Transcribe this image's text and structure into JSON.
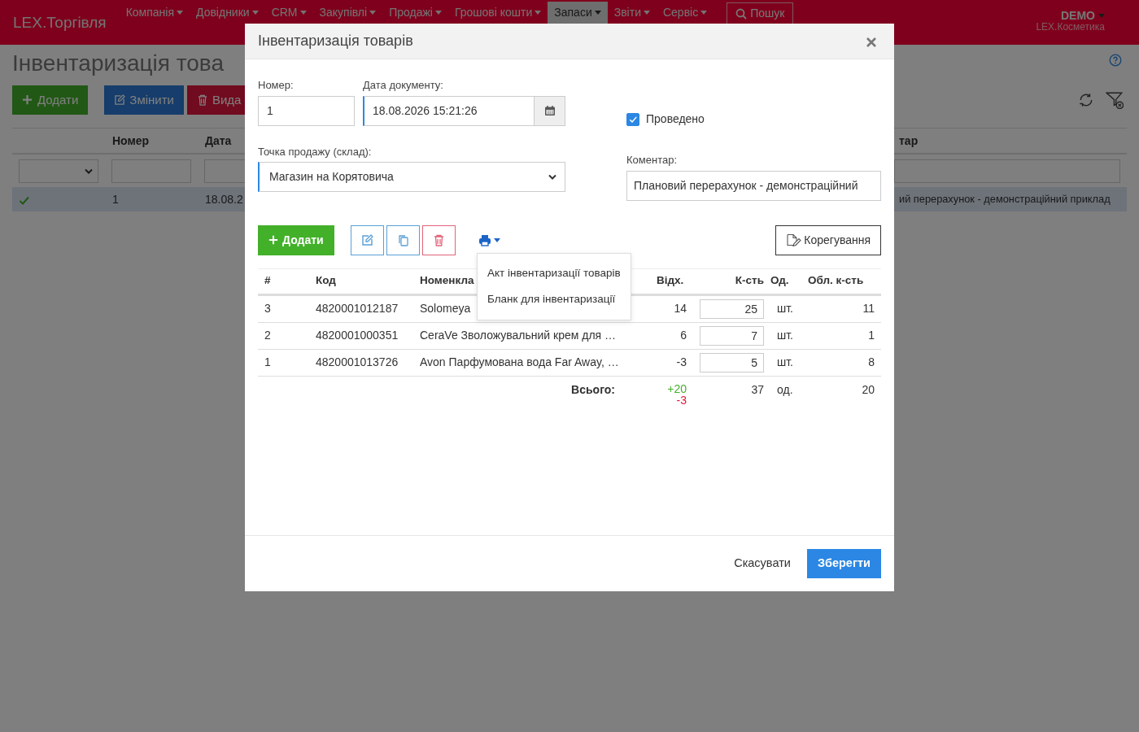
{
  "navbar": {
    "brand": "LEX.Торгівля",
    "menus": [
      {
        "label": "Компанія",
        "selected": false
      },
      {
        "label": "Довідники",
        "selected": false
      },
      {
        "label": "CRM",
        "selected": false
      },
      {
        "label": "Закупівлі",
        "selected": false
      },
      {
        "label": "Продажі",
        "selected": false
      },
      {
        "label": "Грошові кошти",
        "selected": false
      },
      {
        "label": "Запаси",
        "selected": true
      },
      {
        "label": "Звіти",
        "selected": false
      },
      {
        "label": "Сервіс",
        "selected": false
      }
    ],
    "search_button": "Пошук",
    "user": {
      "name": "DEMO",
      "company": "LEX.Косметика"
    }
  },
  "page": {
    "title": "Інвентаризація това",
    "buttons": [
      {
        "label": "Додати",
        "kind": "add"
      },
      {
        "label": "Змінити",
        "kind": "edit"
      },
      {
        "label": "Вида",
        "kind": "delete"
      }
    ],
    "table": {
      "columns": [
        "Номер",
        "Дата"
      ],
      "last_column": "тар",
      "rows": [
        {
          "posted": true,
          "number": "1",
          "date": "18.08.2",
          "comment": "ий перерахунок - демонстраційний приклад",
          "selected": true
        }
      ]
    }
  },
  "dialog": {
    "title": "Інвентаризація товарів",
    "number": {
      "label": "Номер:",
      "value": "1"
    },
    "date": {
      "label": "Дата документу:",
      "value": "18.08.2026 15:21:26"
    },
    "posted": {
      "label": "Проведено",
      "checked": true
    },
    "store": {
      "label": "Точка продажу (склад):",
      "value": "Магазин на Корятовича"
    },
    "comment": {
      "label": "Коментар:",
      "value": "Плановий перерахунок - демонстраційний"
    },
    "add_button": "Додати",
    "adjust_button": "Корегування",
    "print_menu": [
      "Акт інвентаризації товарів",
      "Бланк для інвентаризації"
    ],
    "table": {
      "columns": [
        "#",
        "Код",
        "Номенкла",
        "Відх.",
        "К-сть",
        "Од.",
        "Обл. к-сть"
      ],
      "rows": [
        {
          "index": "3",
          "code": "4820001012187",
          "name": "Solomeya",
          "deviation": "14",
          "quantity": "25",
          "unit": "шт.",
          "book_quantity": "11"
        },
        {
          "index": "2",
          "code": "4820001000351",
          "name": "CeraVe Зволожувальний крем для …",
          "deviation": "6",
          "quantity": "7",
          "unit": "шт.",
          "book_quantity": "1"
        },
        {
          "index": "1",
          "code": "4820001013726",
          "name": "Avon Парфумована вода Far Away, …",
          "deviation": "-3",
          "quantity": "5",
          "unit": "шт.",
          "book_quantity": "8"
        }
      ],
      "totals": {
        "label": "Всього:",
        "surplus": "+20",
        "shortage": "-3",
        "quantity": "37",
        "unit": "од.",
        "book_quantity": "20"
      }
    },
    "cancel_button": "Скасувати",
    "save_button": "Зберегти"
  }
}
